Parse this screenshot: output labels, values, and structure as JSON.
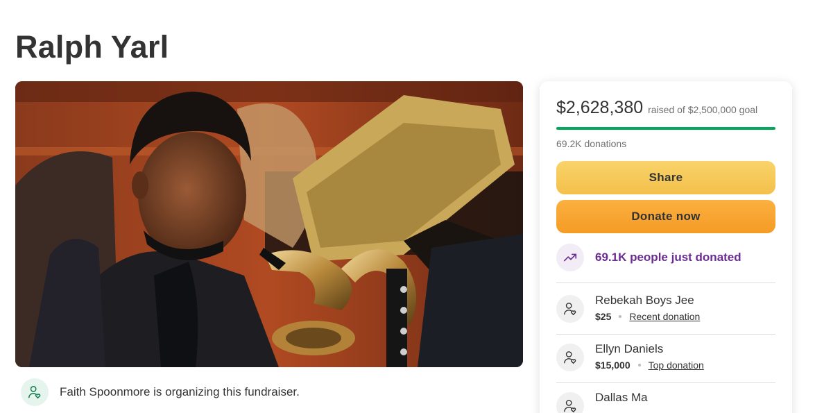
{
  "page": {
    "title": "Ralph Yarl"
  },
  "hero": {
    "alt": "Photo of Ralph Yarl playing a bass clarinet"
  },
  "organizer": {
    "text": "Faith Spoonmore is organizing this fundraiser.",
    "icon": "user-heart-icon"
  },
  "card": {
    "raised_amount": "$2,628,380",
    "raised_goal": "raised of $2,500,000 goal",
    "progress_fraction": 1.0,
    "donations_count": "69.2K donations",
    "share_label": "Share",
    "donate_label": "Donate now",
    "trend_text": "69.1K people just donated",
    "trend_icon": "trending-up-icon",
    "colors": {
      "progress": "#02a95c",
      "share": "#f3c04a",
      "donate": "#f59b25",
      "trend_text": "#6b2c91"
    }
  },
  "donors": [
    {
      "name": "Rebekah Boys Jee",
      "amount": "$25",
      "tag": "Recent donation"
    },
    {
      "name": "Ellyn Daniels",
      "amount": "$15,000",
      "tag": "Top donation"
    },
    {
      "name": "Dallas Ma",
      "amount": "",
      "tag": ""
    }
  ]
}
